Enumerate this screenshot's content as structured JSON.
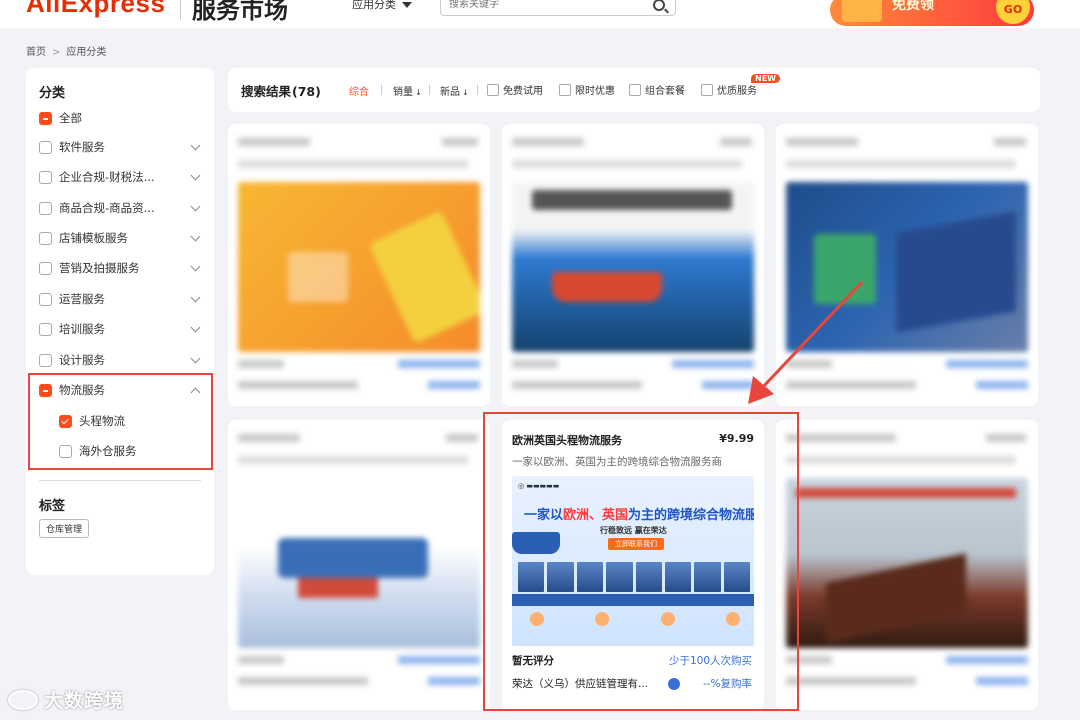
{
  "header": {
    "logo": "AliExpress",
    "subtitle": "服务市场",
    "nav_dropdown": "应用分类",
    "search_placeholder": "搜索关键字",
    "promo_text": "免费领",
    "promo_go": "GO"
  },
  "breadcrumb": [
    "首页",
    "应用分类"
  ],
  "sidebar": {
    "category_title": "分类",
    "categories": [
      {
        "label": "全部",
        "state": "partial"
      },
      {
        "label": "软件服务"
      },
      {
        "label": "企业合规-财税法..."
      },
      {
        "label": "商品合规-商品资..."
      },
      {
        "label": "店铺模板服务"
      },
      {
        "label": "营销及拍摄服务"
      },
      {
        "label": "运营服务"
      },
      {
        "label": "培训服务"
      },
      {
        "label": "设计服务"
      },
      {
        "label": "物流服务",
        "state": "partial",
        "expanded": true
      }
    ],
    "subcategories": [
      {
        "label": "头程物流",
        "checked": true
      },
      {
        "label": "海外仓服务",
        "checked": false
      }
    ],
    "tag_title": "标签",
    "tags": [
      "仓库管理"
    ]
  },
  "filter": {
    "results_label": "搜索结果",
    "results_count": "(78)",
    "sorts": [
      "综合",
      "销量",
      "新品"
    ],
    "sort_arrow": "↓",
    "checks": [
      "免费试用",
      "限时优惠",
      "组合套餐",
      "优质服务"
    ],
    "new_badge": "NEW"
  },
  "highlighted_card": {
    "title": "欧洲英国头程物流服务",
    "price": "¥9.99",
    "description": "一家以欧洲、英国为主的跨境综合物流服务商",
    "banner": {
      "headline_a": "一家以",
      "headline_b": "欧洲、英国",
      "headline_c": "为主的跨境综合物流服务商",
      "subline": "行稳致远  赢在荣达",
      "button": "立即联系我们"
    },
    "rating": "暂无评分",
    "sales": "少于100人次购买",
    "company": "荣达（义乌）供应链管理有...",
    "rebuy": "--%复购率"
  },
  "colors": {
    "accent": "#ff4a1a",
    "highlight_border": "#e8453c",
    "link_blue": "#3a6fd8"
  },
  "watermark": "大数跨境"
}
